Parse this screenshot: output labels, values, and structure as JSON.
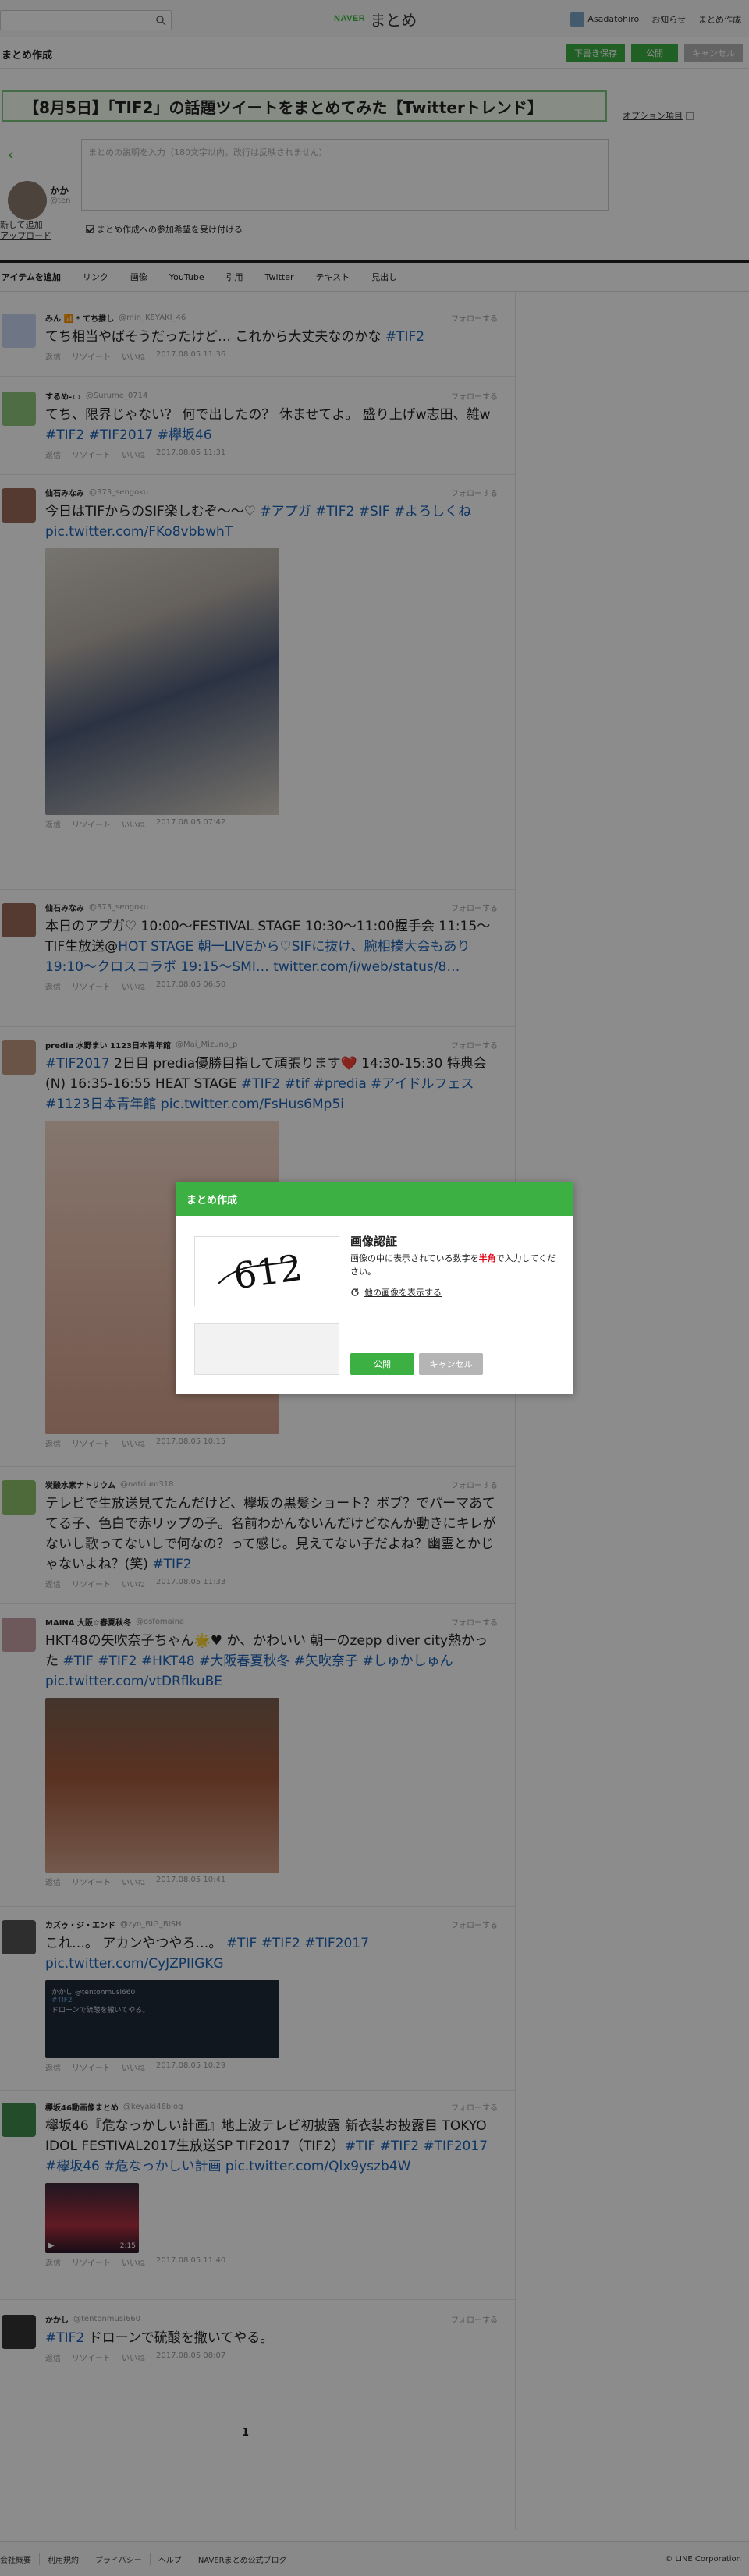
{
  "topnav": {
    "search_placeholder": "",
    "logo_brand": "NAVER",
    "logo_name": "まとめ",
    "username": "Asadatohiro",
    "notices": "お知らせ",
    "create": "まとめ作成"
  },
  "editor": {
    "page_label": "まとめ作成",
    "draft_label": "下書き保存",
    "publish_label": "公開",
    "cancel_label": "キャンセル",
    "title_value": "【8月5日】「TIF2」の話題ツイートをまとめてみた【Twitterトレンド】",
    "option_label": "オプション項目",
    "author_name": "かか",
    "author_id": "@ten",
    "description_placeholder": "まとめの説明を入力（180文字以内。改行は反映されません）",
    "left_link_1": "新して追加",
    "left_link_2": "アップロード",
    "participate_label": "まとめ作成への参加希望を受け付ける"
  },
  "toolbar": {
    "items": [
      "アイテムを追加",
      "リンク",
      "画像",
      "YouTube",
      "引用",
      "Twitter",
      "テキスト",
      "見出し"
    ]
  },
  "tweet_common": {
    "follow": "フォローする",
    "reply": "返信",
    "retweet": "リツイート",
    "like": "いいね"
  },
  "tweets": [
    {
      "name": "みん 📶 * てち推し",
      "id": "@min_KEYAKI_46",
      "text": "てち相当やばそうだったけど… これから大丈夫なのかな ",
      "tags": "#TIF2",
      "time": "2017.08.05 11:36"
    },
    {
      "name": "するめ-‹ ›",
      "id": "@Surume_0714",
      "text": "てち、限界じゃない？ 何で出したの？ 休ませてよ。 盛り上げw志田、雑w ",
      "tags": "#TIF2 #TIF2017 #欅坂46",
      "time": "2017.08.05 11:31"
    },
    {
      "name": "仙石みなみ",
      "id": "@373_sengoku",
      "text": "今日はTIFからのSIF楽しむぞ〜〜♡ ",
      "tags": "#アプガ #TIF2 #SIF #よろしくね pic.twitter.com/FKo8vbbwhT",
      "time": "2017.08.05 07:42"
    },
    {
      "name": "仙石みなみ",
      "id": "@373_sengoku",
      "text": "本日のアプガ♡ 10:00〜FESTIVAL STAGE 10:30〜11:00握手会 11:15〜TIF生放送@",
      "tags": "HOT STAGE 朝一LIVEから♡SIFに抜け、腕相撲大会もあり 19:10〜クロスコラボ 19:15〜SMI… twitter.com/i/web/status/8…",
      "time": "2017.08.05 06:50"
    },
    {
      "name": "predia 水野まい 1123日本青年館",
      "id": "@Mai_Mizuno_p",
      "text": "2日目 predia優勝目指して頑張ります❤️ 14:30-15:30 特典会(N) 16:35-16:55 HEAT STAGE ",
      "lead": "#TIF2017",
      "tags": "#TIF2 #tif #predia #アイドルフェス #1123日本青年館 pic.twitter.com/FsHus6Mp5i",
      "time": "2017.08.05 10:15"
    },
    {
      "name": "炭酸水素ナトリウム",
      "id": "@natrium318",
      "text": "テレビで生放送見てたんだけど、欅坂の黒髪ショート？ボブ？でパーマあててる子、色白で赤リップの子。名前わかんないんだけどなんか動きにキレがないし歌ってないしで何なの？って感じ。見えてない子だよね？幽霊とかじゃないよね？(笑) ",
      "tags": "#TIF2",
      "time": "2017.08.05 11:33"
    },
    {
      "name": "MAINA 大阪☆春夏秋冬",
      "id": "@osfomaina",
      "text": "HKT48の矢吹奈子ちゃん🌟♥ か、かわいい 朝一のzepp diver city熱かった ",
      "tags": "#TIF #TIF2 #HKT48 #大阪春夏秋冬 #矢吹奈子 #しゅかしゅん pic.twitter.com/vtDRflkuBE",
      "time": "2017.08.05 10:41"
    },
    {
      "name": "カズゥ・ジ・エンド",
      "id": "@zyo_BIG_BISH",
      "text": "これ…。 アカンやつやろ…。 ",
      "tags": "#TIF #TIF2 #TIF2017 pic.twitter.com/CyJZPIIGKG",
      "time": "2017.08.05 10:29"
    },
    {
      "name": "欅坂46動画像まとめ",
      "id": "@keyaki46blog",
      "text": "欅坂46『危なっかしい計画』地上波テレビ初披露 新衣装お披露目 TOKYO IDOL FESTIVAL2017生放送SP TIF2017（TIF2）",
      "tags": "#TIF #TIF2 #TIF2017 #欅坂46 #危なっかしい計画 pic.twitter.com/Qlx9yszb4W",
      "time": "2017.08.05 11:40"
    },
    {
      "name": "かかし",
      "id": "@tentonmusi660",
      "text": "ドローンで硫酸を撒いてやる。",
      "lead": "#TIF2",
      "tags": "",
      "time": "2017.08.05 08:07"
    }
  ],
  "embedded_tweet": {
    "name": "かかし",
    "id": "@tentonmusi660",
    "tag": "#TIF2",
    "text": "ドローンで硫酸を撒いてやる。"
  },
  "video_duration": "2:15",
  "pager": "1",
  "footer": {
    "links": [
      "会社概要",
      "利用規約",
      "プライバシー",
      "ヘルプ",
      "NAVERまとめ公式ブログ"
    ],
    "copyright": "© LINE Corporation"
  },
  "modal": {
    "header": "まとめ作成",
    "captcha_text": "612",
    "title": "画像認証",
    "desc_1": "画像の中に表示されている数字を",
    "desc_red": "半角",
    "desc_2": "で入力してください。",
    "reload_label": "他の画像を表示する",
    "publish_label": "公開",
    "cancel_label": "キャンセル"
  },
  "colors": {
    "accent": "#3cb043",
    "link": "#1a62b5",
    "alert": "#e60012"
  }
}
